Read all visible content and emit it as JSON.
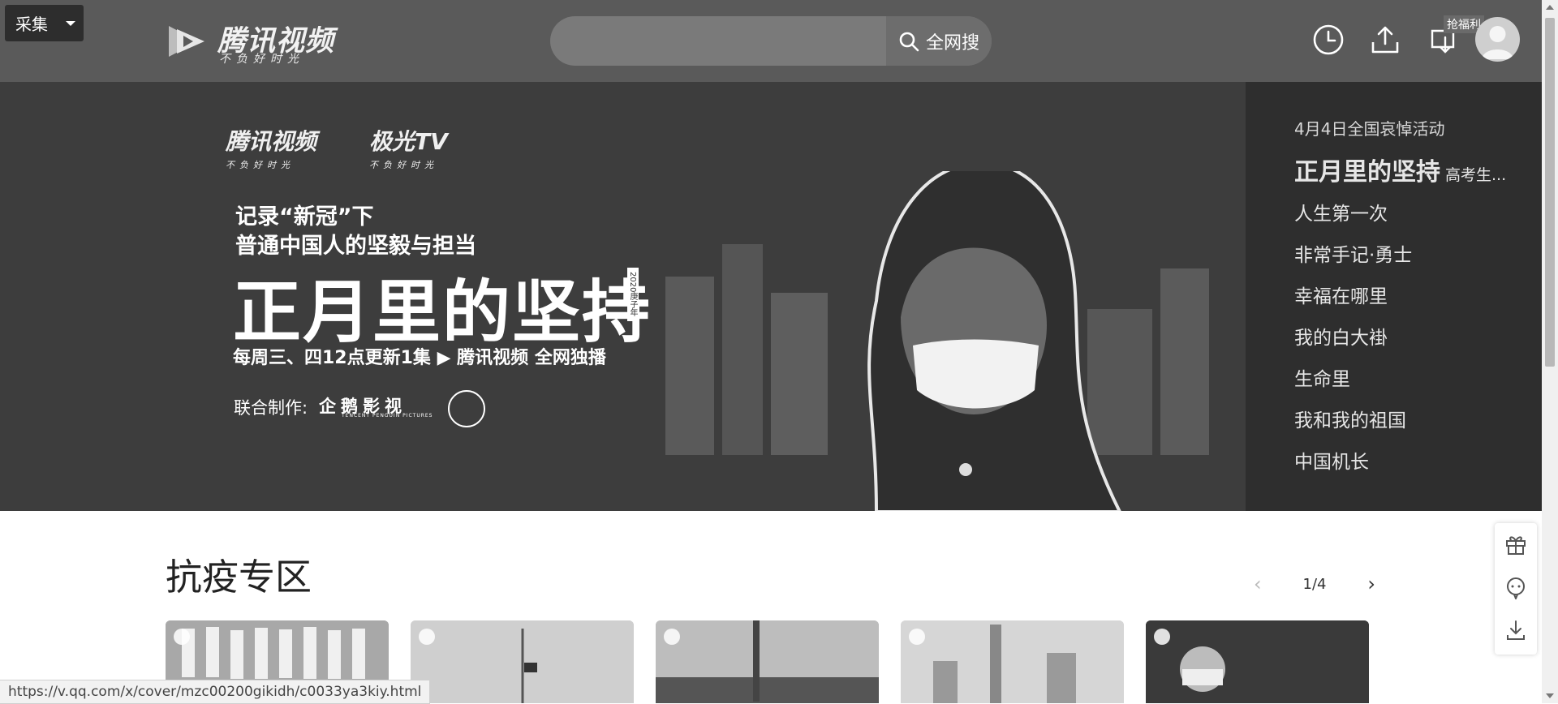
{
  "toolbar": {
    "collect_label": "采集"
  },
  "header": {
    "logo": {
      "brand": "腾讯视频",
      "slogan": "不负好时光"
    },
    "search": {
      "value": "",
      "placeholder": "",
      "button_label": "全网搜"
    },
    "icons": [
      "history-icon",
      "upload-icon",
      "download-device-icon"
    ],
    "fuli_badge": "抢福利"
  },
  "banner": {
    "logos": [
      {
        "brand": "腾讯视频",
        "slogan": "不负好时光"
      },
      {
        "brand": "极光TV",
        "slogan": "不负好时光"
      }
    ],
    "tagline1": "记录“新冠”下",
    "tagline2": "普通中国人的坚毅与担当",
    "title": "正月里的坚持",
    "year_badge": "2020庚子年",
    "update": "每周三、四12点更新1集 ▶ 腾讯视频 全网独播",
    "producer_label": "联合制作:",
    "producer_name": "企鹅影视",
    "producer_name_en": "TENCENT PENGUIN PICTURES"
  },
  "sidelist": {
    "items": [
      {
        "label": "4月4日全国哀悼活动"
      },
      {
        "label": "正月里的坚持",
        "sub": "高考生..."
      },
      {
        "label": "人生第一次"
      },
      {
        "label": "非常手记·勇士"
      },
      {
        "label": "幸福在哪里"
      },
      {
        "label": "我的白大褂"
      },
      {
        "label": "生命里"
      },
      {
        "label": "我和我的祖国"
      },
      {
        "label": "中国机长"
      }
    ]
  },
  "section": {
    "title": "抗疫专区",
    "pager": {
      "current": "1",
      "separator": "/",
      "total": "4"
    }
  },
  "status": {
    "url": "https://v.qq.com/x/cover/mzc00200gikidh/c0033ya3kiy.html"
  }
}
